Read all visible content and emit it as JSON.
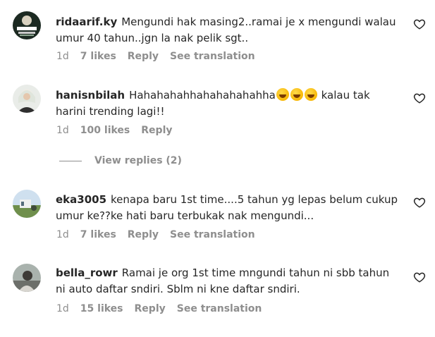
{
  "comments": [
    {
      "username": "ridaarif.ky",
      "text": "Mengundi hak masing2..ramai je x mengundi walau umur 40 tahun..jgn la nak pelik sgt..",
      "time": "1d",
      "likes": "7 likes",
      "reply": "Reply",
      "translate": "See translation"
    },
    {
      "username": "hanisnbilah",
      "text_before": "Hahahahahhahahahahahha",
      "emoji": "rolling-on-floor-laughing-emoji",
      "text_after": "kalau tak harini trending lagi!!",
      "time": "1d",
      "likes": "100 likes",
      "reply": "Reply",
      "view_replies": "View replies (2)"
    },
    {
      "username": "eka3005",
      "text": "kenapa baru 1st time....5 tahun yg lepas belum cukup umur ke??ke hati baru terbukak nak mengundi...",
      "time": "1d",
      "likes": "7 likes",
      "reply": "Reply",
      "translate": "See translation"
    },
    {
      "username": "bella_rowr",
      "text": "Ramai je org 1st time mngundi tahun ni sbb tahun ni auto daftar sndiri. Sblm ni kne daftar sndiri.",
      "time": "1d",
      "likes": "15 likes",
      "reply": "Reply",
      "translate": "See translation"
    }
  ],
  "icons": {
    "like": "heart-outline-icon"
  },
  "colors": {
    "text": "#262626",
    "secondary": "#8e8e8e",
    "background": "#ffffff"
  }
}
